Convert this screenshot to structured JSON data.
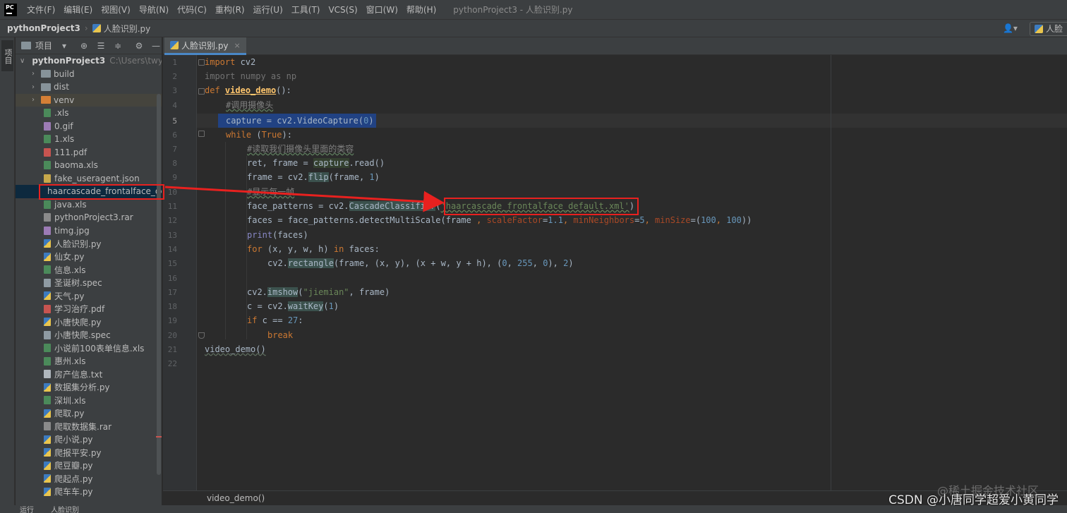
{
  "menubar": {
    "logo": "PC",
    "items": [
      "文件(F)",
      "编辑(E)",
      "视图(V)",
      "导航(N)",
      "代码(C)",
      "重构(R)",
      "运行(U)",
      "工具(T)",
      "VCS(S)",
      "窗口(W)",
      "帮助(H)"
    ],
    "window_title": "pythonProject3 - 人脸识别.py"
  },
  "navbar": {
    "project": "pythonProject3",
    "file": "人脸识别.py",
    "user_icon": "user-icon",
    "run_config": "人脸"
  },
  "left_stripe": {
    "project_label": "项目"
  },
  "project_panel": {
    "title": "项目",
    "toolbar_icons": [
      "target-icon",
      "expand-all-icon",
      "collapse-all-icon",
      "gear-icon",
      "minimize-icon"
    ],
    "root": {
      "name": "pythonProject3",
      "path": "C:\\Users\\twy\\P"
    },
    "folders": [
      "build",
      "dist",
      "venv"
    ],
    "files": [
      {
        "name": ".xls",
        "type": "xls"
      },
      {
        "name": "0.gif",
        "type": "img"
      },
      {
        "name": "1.xls",
        "type": "xls"
      },
      {
        "name": "111.pdf",
        "type": "pdf"
      },
      {
        "name": "baoma.xls",
        "type": "xls"
      },
      {
        "name": "fake_useragent.json",
        "type": "json"
      },
      {
        "name": "haarcascade_frontalface_default.xml",
        "type": "xml"
      },
      {
        "name": "java.xls",
        "type": "xls"
      },
      {
        "name": "pythonProject3.rar",
        "type": "rar"
      },
      {
        "name": "timg.jpg",
        "type": "img"
      },
      {
        "name": "人脸识别.py",
        "type": "py"
      },
      {
        "name": "仙女.py",
        "type": "py"
      },
      {
        "name": "信息.xls",
        "type": "xls"
      },
      {
        "name": "圣诞树.spec",
        "type": "spec"
      },
      {
        "name": "天气.py",
        "type": "py"
      },
      {
        "name": "学习治疗.pdf",
        "type": "pdf"
      },
      {
        "name": "小唐快爬.py",
        "type": "py"
      },
      {
        "name": "小唐快爬.spec",
        "type": "spec"
      },
      {
        "name": "小说前100表单信息.xls",
        "type": "xls"
      },
      {
        "name": "惠州.xls",
        "type": "xls"
      },
      {
        "name": "房产信息.txt",
        "type": "txt"
      },
      {
        "name": "数据集分析.py",
        "type": "py"
      },
      {
        "name": "深圳.xls",
        "type": "xls"
      },
      {
        "name": "爬取.py",
        "type": "py"
      },
      {
        "name": "爬取数据集.rar",
        "type": "rar"
      },
      {
        "name": "爬小说.py",
        "type": "py"
      },
      {
        "name": "爬报平安.py",
        "type": "py"
      },
      {
        "name": "爬豆瓣.py",
        "type": "py"
      },
      {
        "name": "爬起点.py",
        "type": "py"
      },
      {
        "name": "爬车车.py",
        "type": "py"
      }
    ]
  },
  "editor": {
    "tab": "人脸识别.py",
    "tab_close": "×",
    "breadcrumb": "video_demo()",
    "line_numbers": [
      "1",
      "2",
      "3",
      "4",
      "5",
      "6",
      "7",
      "8",
      "9",
      "10",
      "11",
      "12",
      "13",
      "14",
      "15",
      "16",
      "17",
      "18",
      "19",
      "20",
      "21",
      "22"
    ],
    "code": {
      "l1": [
        "import",
        " cv2"
      ],
      "l2": "import numpy as np",
      "l3": [
        "def",
        " ",
        "video_demo",
        "():"
      ],
      "l4": "#调用摄像头",
      "l5": [
        "capture = cv2.VideoCapture(",
        "0",
        ")"
      ],
      "l6": [
        "while",
        " (",
        "True",
        "):"
      ],
      "l7": "#读取我们摄像头里面的类容",
      "l8": [
        "ret, frame = ",
        "capture",
        ".read()"
      ],
      "l9": [
        "frame = cv2.",
        "flip",
        "(frame, ",
        "1",
        ")"
      ],
      "l10": "#显示每一帧",
      "l11": [
        "face_patterns = cv2.",
        "CascadeClassifier",
        "(",
        "'haarcascade_frontalface_default.xml'",
        ")"
      ],
      "l12": [
        "faces = face_patterns.detectMultiScale(frame ",
        ", ",
        "scaleFactor",
        "=",
        "1.1",
        ", ",
        "minNeighbors",
        "=",
        "5",
        ", ",
        "minSize",
        "=(",
        "100",
        ", ",
        "100",
        "))"
      ],
      "l13": [
        "print",
        "(faces)"
      ],
      "l14": [
        "for",
        " (x, y, w, h) ",
        "in",
        " faces:"
      ],
      "l15": [
        "cv2.",
        "rectangle",
        "(frame, (x, y), (x + w, y + h), (",
        "0",
        ", ",
        "255",
        ", ",
        "0",
        "), ",
        "2",
        ")"
      ],
      "l17": [
        "cv2.",
        "imshow",
        "(",
        "\"jiemian\"",
        ", frame)"
      ],
      "l18": [
        "c = cv2.",
        "waitKey",
        "(",
        "1",
        ")"
      ],
      "l19": [
        "if",
        " c == ",
        "27",
        ":"
      ],
      "l20": "break",
      "l21": "video_demo()"
    }
  },
  "bottom_strip": {
    "run": "运行",
    "file": "人脸识别"
  },
  "watermark": {
    "text": "CSDN @小唐同学超爱小黄同学",
    "faint": "@稀土掘金技术社区"
  },
  "colors": {
    "annotation": "#e8211f",
    "selection": "#214283",
    "keyword": "#cc7832",
    "string": "#6a8759",
    "number": "#6897bb",
    "function": "#ffc66d"
  }
}
